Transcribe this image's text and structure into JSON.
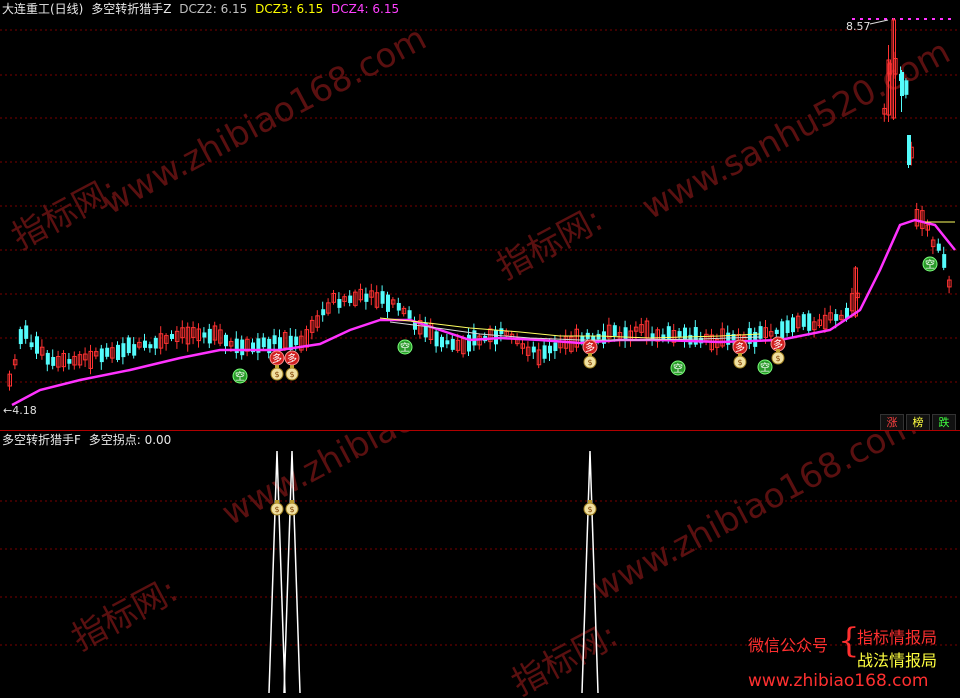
{
  "header": {
    "stock": "大连重工(日线)",
    "indicator": "多空转折猎手Z",
    "dcz2_label": "DCZ2: 6.15",
    "dcz3_label": "DCZ3: 6.15",
    "dcz4_label": "DCZ4: 6.15"
  },
  "price": {
    "high_label": "8.57",
    "low_label": "←4.18"
  },
  "sub_header": {
    "indicator": "多空转折猎手F",
    "value_label": "多空拐点: 0.00"
  },
  "buttons": {
    "up": "涨",
    "rank": "榜",
    "down": "跌"
  },
  "signal_labels": {
    "kong": "空",
    "duo": "多",
    "money": "$"
  },
  "watermarks": [
    "www.zhibiao168.com",
    "www.sanhu520.com",
    "指标网:"
  ],
  "promo": {
    "line1": "微信公众号",
    "brace": "{",
    "line2": "指标情报局",
    "line3": "战法情报局",
    "url": "www.zhibiao168.com"
  },
  "colors": {
    "up": "#ff3232",
    "down": "#54fcfc",
    "ma": "#ff32ff",
    "grid": "#7a0000",
    "promo_red": "#ff3030",
    "promo_yellow": "#ffff40"
  }
}
